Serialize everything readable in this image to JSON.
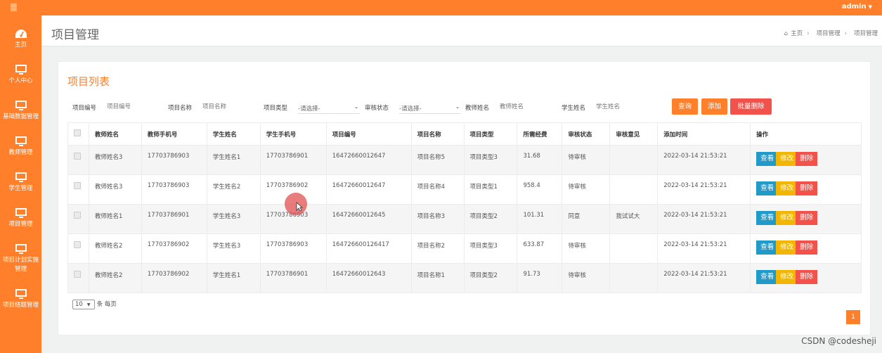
{
  "topbar": {
    "logo": "䷀",
    "user": "admin"
  },
  "sidebar": {
    "items": [
      {
        "label": "主页",
        "icon": "dashboard-icon"
      },
      {
        "label": "个人中心",
        "icon": "monitor-icon"
      },
      {
        "label": "基础数据管理",
        "icon": "monitor-icon"
      },
      {
        "label": "教师管理",
        "icon": "monitor-icon"
      },
      {
        "label": "学生管理",
        "icon": "monitor-icon"
      },
      {
        "label": "项目管理",
        "icon": "monitor-icon"
      },
      {
        "label": "项目计划实施",
        "label2": "管理",
        "icon": "monitor-icon"
      },
      {
        "label": "项目结题管理",
        "icon": "monitor-icon"
      }
    ]
  },
  "header": {
    "title": "项目管理",
    "breadcrumb": [
      "主页",
      "项目管理",
      "项目管理"
    ]
  },
  "panel": {
    "title": "项目列表",
    "search": {
      "project_no_label": "项目编号",
      "project_no_placeholder": "项目编号",
      "project_name_label": "项目名称",
      "project_name_placeholder": "项目名称",
      "project_type_label": "项目类型",
      "project_type_value": "-请选择-",
      "audit_status_label": "审核状态",
      "audit_status_value": "-请选择-",
      "teacher_name_label": "教师姓名",
      "teacher_name_placeholder": "教师姓名",
      "student_name_label": "学生姓名",
      "student_name_placeholder": "学生姓名",
      "query_button": "查询",
      "add_button": "添加",
      "batch_delete_button": "批量删除"
    },
    "table": {
      "headers": [
        "教师姓名",
        "教师手机号",
        "学生姓名",
        "学生手机号",
        "项目编号",
        "项目名称",
        "项目类型",
        "所需经费",
        "审核状态",
        "审核意见",
        "添加时间",
        "操作"
      ],
      "actions": {
        "view": "查看",
        "edit": "修改",
        "delete": "删除"
      },
      "rows": [
        [
          "教师姓名3",
          "17703786903",
          "学生姓名1",
          "17703786901",
          "16472660012647",
          "项目名称5",
          "项目类型3",
          "31.68",
          "待审核",
          "",
          "2022-03-14 21:53:21"
        ],
        [
          "教师姓名3",
          "17703786903",
          "学生姓名2",
          "17703786902",
          "16472660012647",
          "项目名称4",
          "项目类型1",
          "958.4",
          "待审核",
          "",
          "2022-03-14 21:53:21"
        ],
        [
          "教师姓名1",
          "17703786901",
          "学生姓名3",
          "17703786903",
          "16472660012645",
          "项目名称3",
          "项目类型2",
          "101.31",
          "同意",
          "我试试大",
          "2022-03-14 21:53:21"
        ],
        [
          "教师姓名2",
          "17703786902",
          "学生姓名3",
          "17703786903",
          "164726600126417",
          "项目名称2",
          "项目类型3",
          "633.87",
          "待审核",
          "",
          "2022-03-14 21:53:21"
        ],
        [
          "教师姓名2",
          "17703786902",
          "学生姓名1",
          "17703786901",
          "16472660012643",
          "项目名称1",
          "项目类型2",
          "91.73",
          "待审核",
          "",
          "2022-03-14 21:53:21"
        ]
      ]
    },
    "pager": {
      "page_size": "10",
      "suffix": "条 每页",
      "current_page": "1"
    }
  },
  "watermark": "CSDN @codesheji",
  "colors": {
    "accent": "#ff7f2a",
    "danger": "#f3524a",
    "info": "#1f9ac9",
    "warning": "#f2b600"
  }
}
